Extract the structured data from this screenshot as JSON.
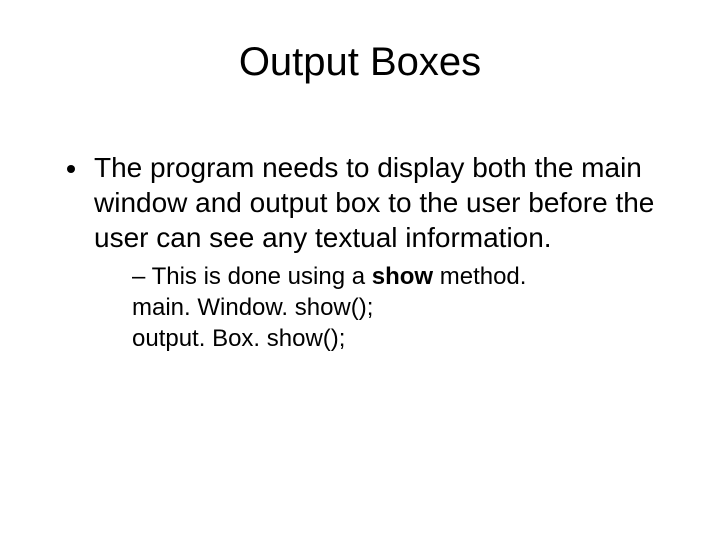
{
  "title": "Output Boxes",
  "bullet1": "The program needs to display both the main window and output box to the user before the user can see any textual information.",
  "sub_prefix": "This is done using a ",
  "sub_bold": "show",
  "sub_suffix": " method.",
  "code1": "main. Window. show();",
  "code2": "output. Box. show();"
}
